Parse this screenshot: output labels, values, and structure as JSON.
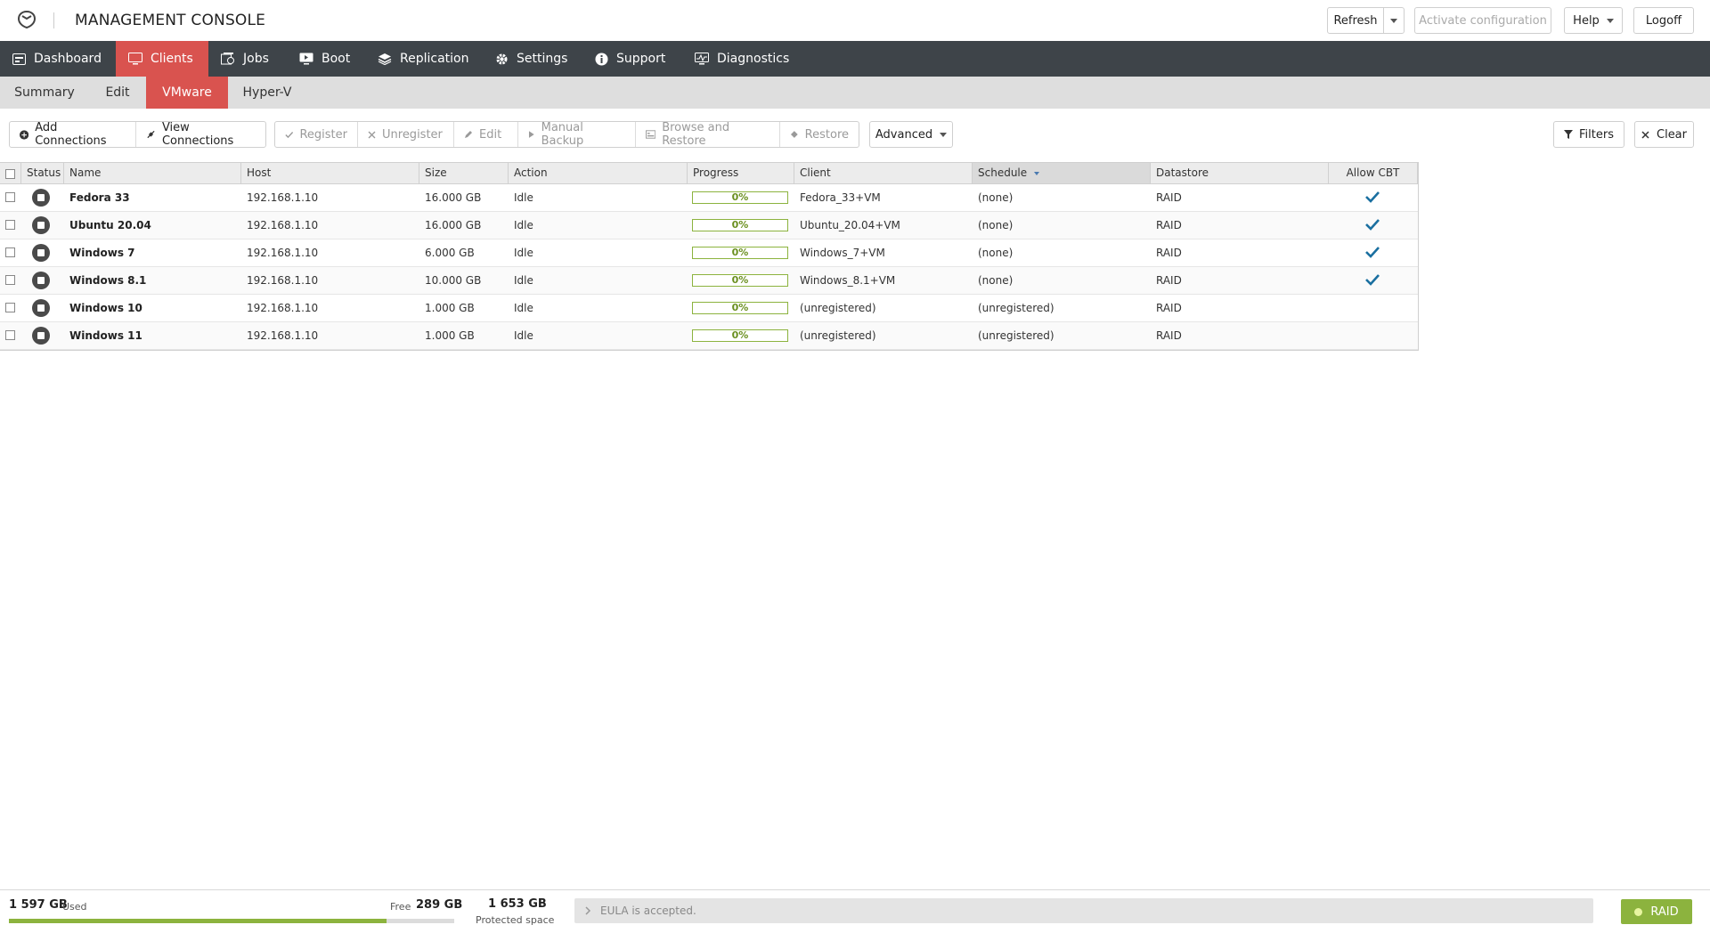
{
  "header": {
    "title": "MANAGEMENT CONSOLE",
    "refresh_label": "Refresh",
    "activate_label": "Activate configuration",
    "help_label": "Help",
    "logoff_label": "Logoff"
  },
  "main_nav": [
    {
      "label": "Dashboard",
      "icon": "dashboard-icon"
    },
    {
      "label": "Clients",
      "icon": "monitor-icon",
      "active": true
    },
    {
      "label": "Jobs",
      "icon": "jobs-icon"
    },
    {
      "label": "Boot",
      "icon": "boot-icon"
    },
    {
      "label": "Replication",
      "icon": "layers-icon"
    },
    {
      "label": "Settings",
      "icon": "gear-icon"
    },
    {
      "label": "Support",
      "icon": "info-icon"
    },
    {
      "label": "Diagnostics",
      "icon": "diagnostics-icon"
    }
  ],
  "sub_nav": [
    {
      "label": "Summary"
    },
    {
      "label": "Edit"
    },
    {
      "label": "VMware",
      "active": true
    },
    {
      "label": "Hyper-V"
    }
  ],
  "toolbar": {
    "add_connections": "Add Connections",
    "view_connections": "View Connections",
    "register": "Register",
    "unregister": "Unregister",
    "edit": "Edit",
    "manual_backup": "Manual Backup",
    "browse_restore": "Browse and Restore",
    "restore": "Restore",
    "advanced": "Advanced",
    "filters": "Filters",
    "clear": "Clear"
  },
  "table": {
    "columns": [
      "Status",
      "Name",
      "Host",
      "Size",
      "Action",
      "Progress",
      "Client",
      "Schedule",
      "Datastore",
      "Allow CBT"
    ],
    "sorted_column": "Schedule",
    "rows": [
      {
        "name": "Fedora 33",
        "host": "192.168.1.10",
        "size": "16.000 GB",
        "action": "Idle",
        "progress": "0%",
        "client": "Fedora_33+VM",
        "schedule": "(none)",
        "datastore": "RAID",
        "cbt": true
      },
      {
        "name": "Ubuntu 20.04",
        "host": "192.168.1.10",
        "size": "16.000 GB",
        "action": "Idle",
        "progress": "0%",
        "client": "Ubuntu_20.04+VM",
        "schedule": "(none)",
        "datastore": "RAID",
        "cbt": true
      },
      {
        "name": "Windows 7",
        "host": "192.168.1.10",
        "size": "6.000 GB",
        "action": "Idle",
        "progress": "0%",
        "client": "Windows_7+VM",
        "schedule": "(none)",
        "datastore": "RAID",
        "cbt": true
      },
      {
        "name": "Windows 8.1",
        "host": "192.168.1.10",
        "size": "10.000 GB",
        "action": "Idle",
        "progress": "0%",
        "client": "Windows_8.1+VM",
        "schedule": "(none)",
        "datastore": "RAID",
        "cbt": true
      },
      {
        "name": "Windows 10",
        "host": "192.168.1.10",
        "size": "1.000 GB",
        "action": "Idle",
        "progress": "0%",
        "client": "(unregistered)",
        "schedule": "(unregistered)",
        "datastore": "RAID",
        "cbt": false
      },
      {
        "name": "Windows 11",
        "host": "192.168.1.10",
        "size": "1.000 GB",
        "action": "Idle",
        "progress": "0%",
        "client": "(unregistered)",
        "schedule": "(unregistered)",
        "datastore": "RAID",
        "cbt": false
      }
    ]
  },
  "footer": {
    "used_value": "1 597 GB",
    "used_label": "Used",
    "free_label": "Free",
    "free_value": "289 GB",
    "used_fraction": 0.847,
    "protected_value": "1 653 GB",
    "protected_label": "Protected space",
    "eula_text": "EULA is accepted.",
    "raid_label": "RAID"
  },
  "colors": {
    "accent_red": "#d9534f",
    "nav_dark": "#3e4449",
    "ok_green": "#8cb33e",
    "check_blue": "#1a6fa0"
  }
}
